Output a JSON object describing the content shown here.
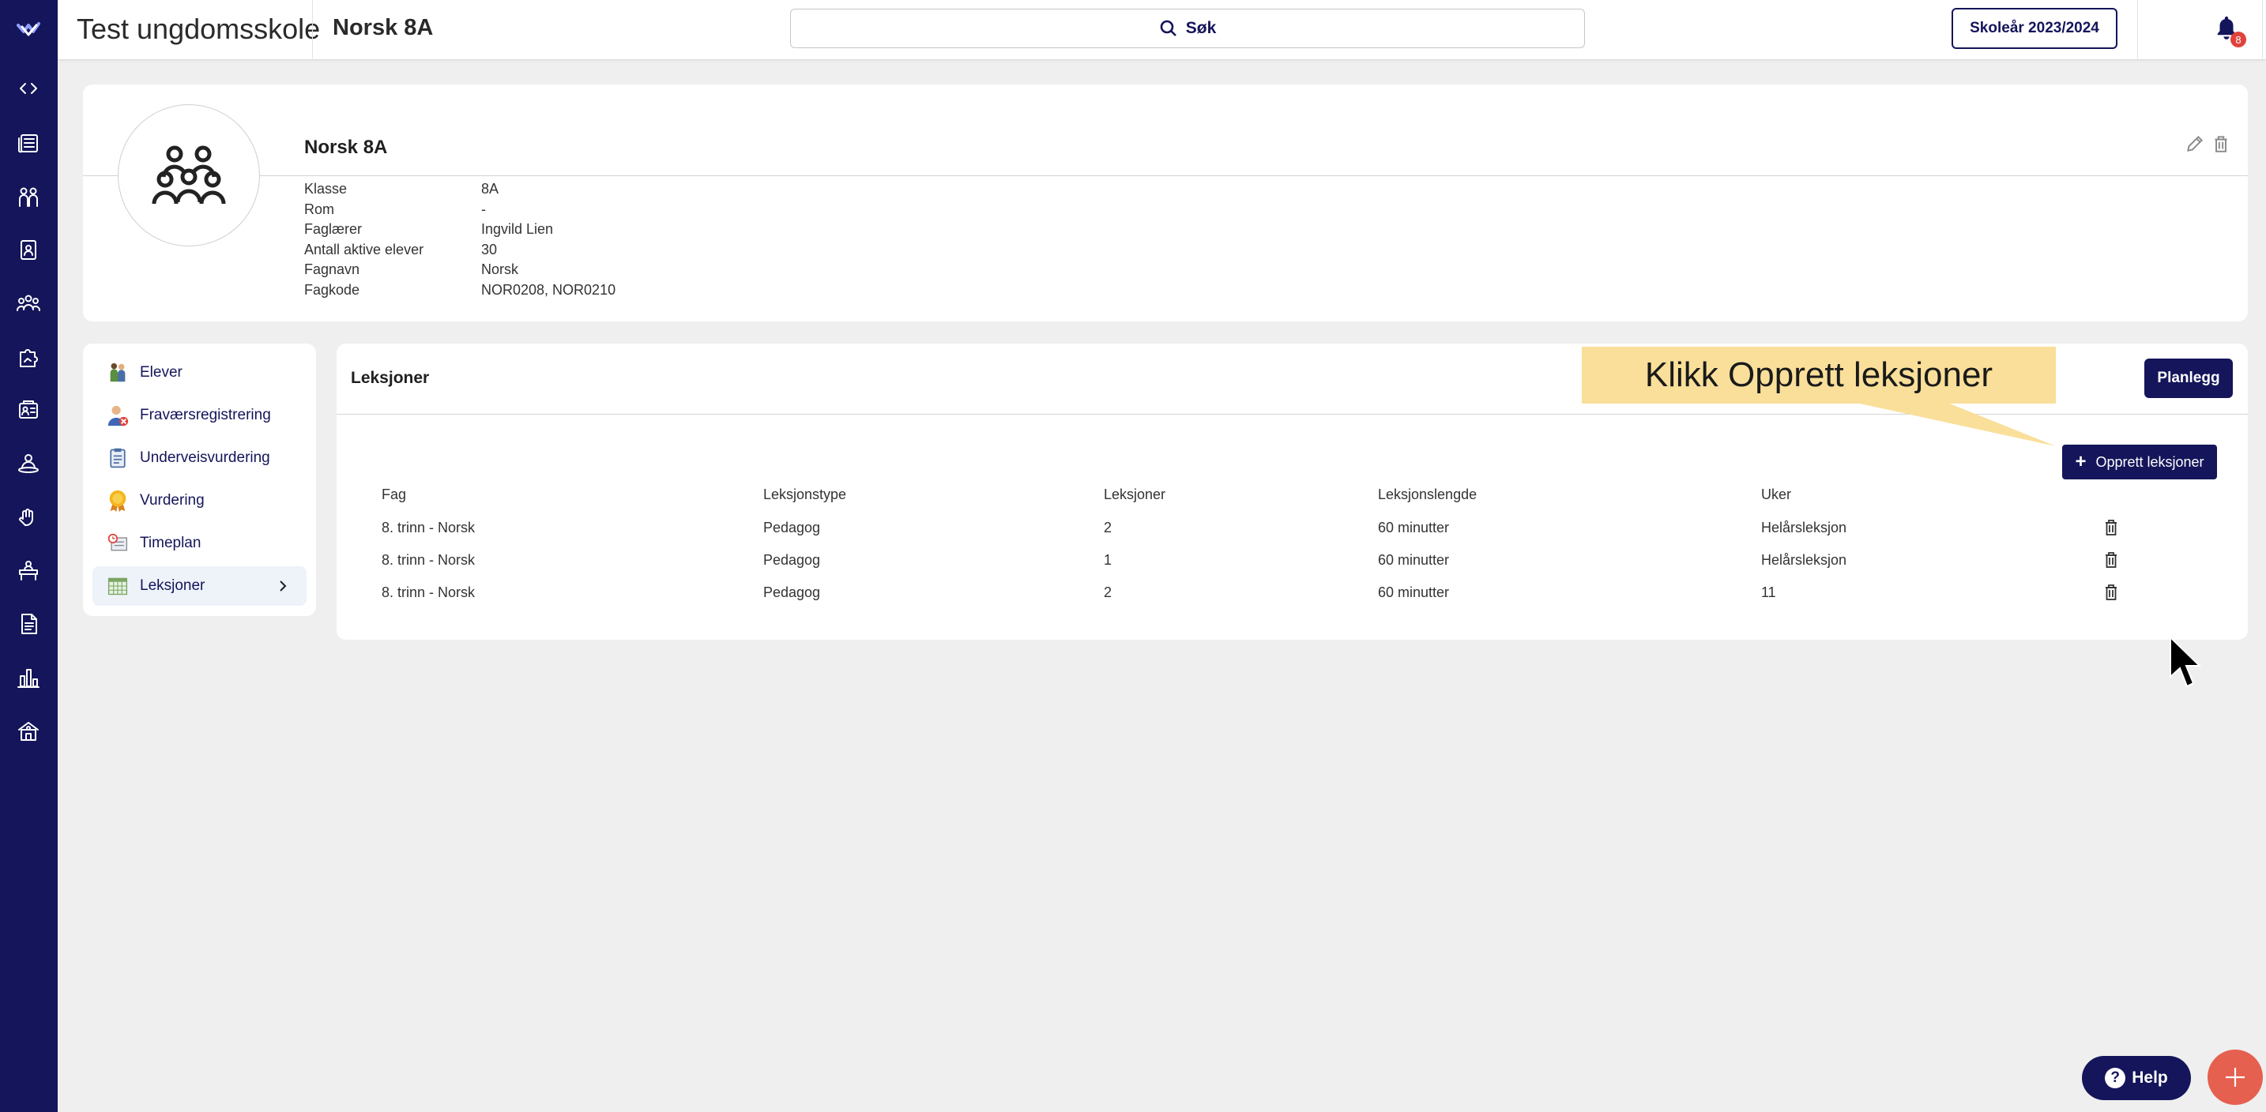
{
  "header": {
    "school_name": "Test ungdomsskole",
    "course": "Norsk 8A",
    "search_placeholder": "Søk",
    "school_year": "Skoleår 2023/2024",
    "notification_count": "8"
  },
  "sidebar": {
    "icons": [
      "logo-icon",
      "collapse-icon",
      "news-icon",
      "groups-icon",
      "contacts-icon",
      "students-icon",
      "puzzle-icon",
      "id-card-icon",
      "teacher-icon",
      "hand-icon",
      "desk-icon",
      "document-icon",
      "stats-icon",
      "school-icon"
    ]
  },
  "info": {
    "title": "Norsk 8A",
    "fields": [
      {
        "label": "Klasse",
        "value": "8A"
      },
      {
        "label": "Rom",
        "value": "-"
      },
      {
        "label": "Faglærer",
        "value": "Ingvild Lien"
      },
      {
        "label": "Antall aktive elever",
        "value": "30"
      },
      {
        "label": "Fagnavn",
        "value": "Norsk"
      },
      {
        "label": "Fagkode",
        "value": "NOR0208, NOR0210"
      }
    ]
  },
  "menu": {
    "items": [
      {
        "label": "Elever",
        "icon": "students-icon"
      },
      {
        "label": "Fraværsregistrering",
        "icon": "absence-icon"
      },
      {
        "label": "Underveisvurdering",
        "icon": "assessment-icon"
      },
      {
        "label": "Vurdering",
        "icon": "medal-icon"
      },
      {
        "label": "Timeplan",
        "icon": "schedule-icon"
      },
      {
        "label": "Leksjoner",
        "icon": "calendar-grid-icon",
        "active": true
      }
    ]
  },
  "lessons": {
    "title": "Leksjoner",
    "plan_button": "Planlegg",
    "create_button": "Opprett leksjoner",
    "columns": [
      "Fag",
      "Leksjonstype",
      "Leksjoner",
      "Leksjonslengde",
      "Uker"
    ],
    "rows": [
      [
        "8. trinn - Norsk",
        "Pedagog",
        "2",
        "60 minutter",
        "Helårsleksjon"
      ],
      [
        "8. trinn - Norsk",
        "Pedagog",
        "1",
        "60 minutter",
        "Helårsleksjon"
      ],
      [
        "8. trinn - Norsk",
        "Pedagog",
        "2",
        "60 minutter",
        "11"
      ]
    ]
  },
  "callout": {
    "text": "Klikk Opprett leksjoner"
  },
  "floating": {
    "help_label": "Help",
    "help_icon": "?"
  },
  "colors": {
    "navy": "#14155a",
    "callout": "#f9df9a",
    "fab": "#e5604f",
    "badge": "#e0433c"
  }
}
